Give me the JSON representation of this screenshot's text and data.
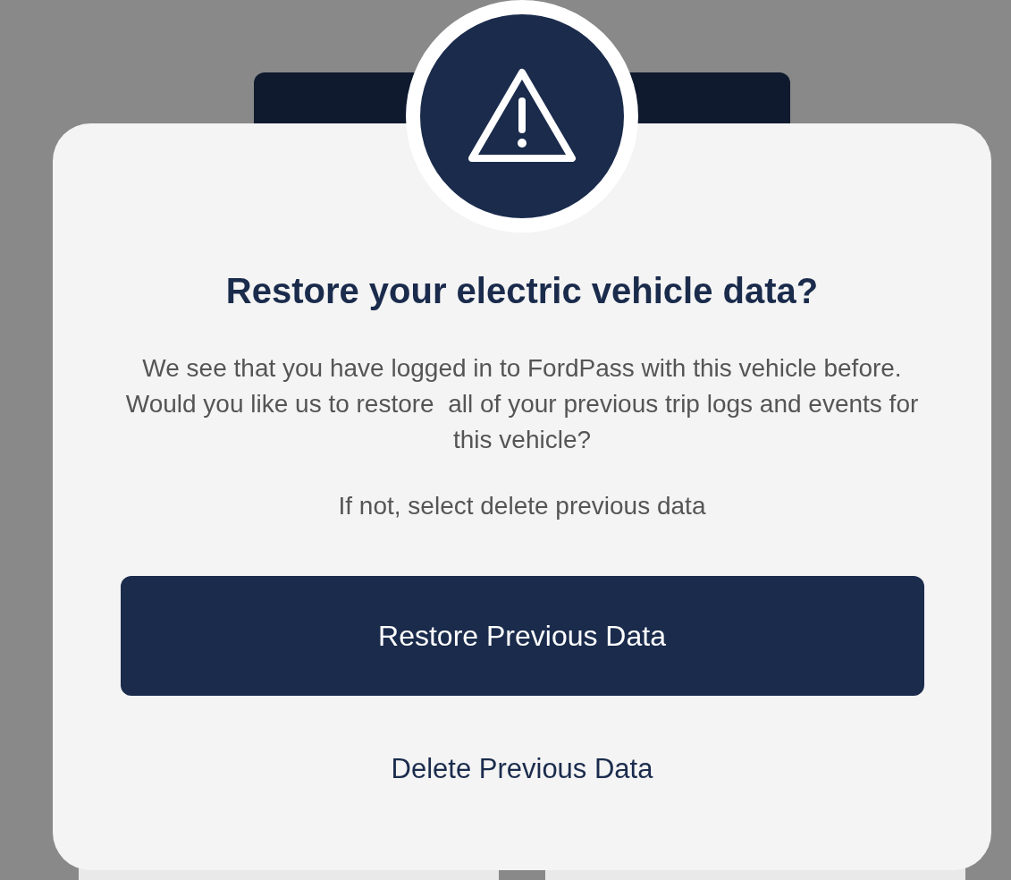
{
  "dialog": {
    "title": "Restore your electric vehicle data?",
    "message": "We see that you have logged in to FordPass with this vehicle before. Would you like us to restore  all of your previous trip logs and events for this vehicle?",
    "hint": "If not, select delete previous data",
    "buttons": [
      {
        "label": "Restore Previous Data",
        "kind": "primary"
      },
      {
        "label": "Delete Previous Data",
        "kind": "link"
      }
    ]
  }
}
